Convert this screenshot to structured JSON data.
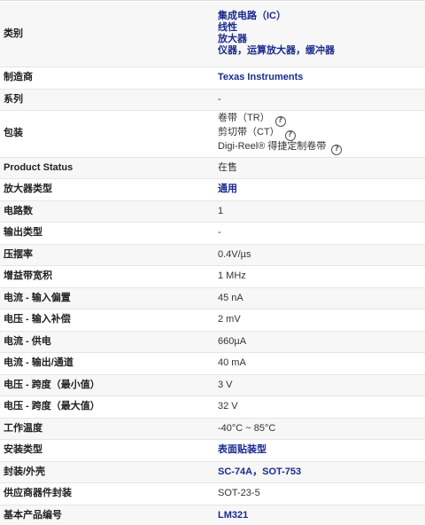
{
  "rows": [
    {
      "label": "类别",
      "type": "links",
      "values": [
        "集成电路（IC）",
        "线性",
        "放大器",
        "仪器，运算放大器，缓冲器"
      ]
    },
    {
      "label": "制造商",
      "type": "link",
      "value": "Texas Instruments"
    },
    {
      "label": "系列",
      "type": "text",
      "value": "-"
    },
    {
      "label": "包装",
      "type": "packaging",
      "values": [
        "卷带（TR）",
        "剪切带（CT）",
        "Digi-Reel® 得捷定制卷带"
      ]
    },
    {
      "label": "Product Status",
      "type": "text",
      "value": "在售"
    },
    {
      "label": "放大器类型",
      "type": "link",
      "value": "通用"
    },
    {
      "label": "电路数",
      "type": "text",
      "value": "1"
    },
    {
      "label": "输出类型",
      "type": "text",
      "value": "-"
    },
    {
      "label": "压摆率",
      "type": "text",
      "value": "0.4V/µs"
    },
    {
      "label": "增益带宽积",
      "type": "text",
      "value": "1 MHz"
    },
    {
      "label": "电流 - 输入偏置",
      "type": "text",
      "value": "45 nA"
    },
    {
      "label": "电压 - 输入补偿",
      "type": "text",
      "value": "2 mV"
    },
    {
      "label": "电流 - 供电",
      "type": "text",
      "value": "660µA"
    },
    {
      "label": "电流 - 输出/通道",
      "type": "text",
      "value": "40 mA"
    },
    {
      "label": "电压 - 跨度（最小值）",
      "type": "text",
      "value": "3 V"
    },
    {
      "label": "电压 - 跨度（最大值）",
      "type": "text",
      "value": "32 V"
    },
    {
      "label": "工作温度",
      "type": "text",
      "value": "-40°C ~ 85°C"
    },
    {
      "label": "安装类型",
      "type": "link",
      "value": "表面贴装型"
    },
    {
      "label": "封装/外壳",
      "type": "links-inline",
      "values": [
        "SC-74A",
        "SOT-753"
      ],
      "separator": "，"
    },
    {
      "label": "供应商器件封装",
      "type": "text",
      "value": "SOT-23-5"
    },
    {
      "label": "基本产品编号",
      "type": "link",
      "value": "LM321"
    }
  ],
  "icons": {
    "help": "help-circle-icon"
  }
}
